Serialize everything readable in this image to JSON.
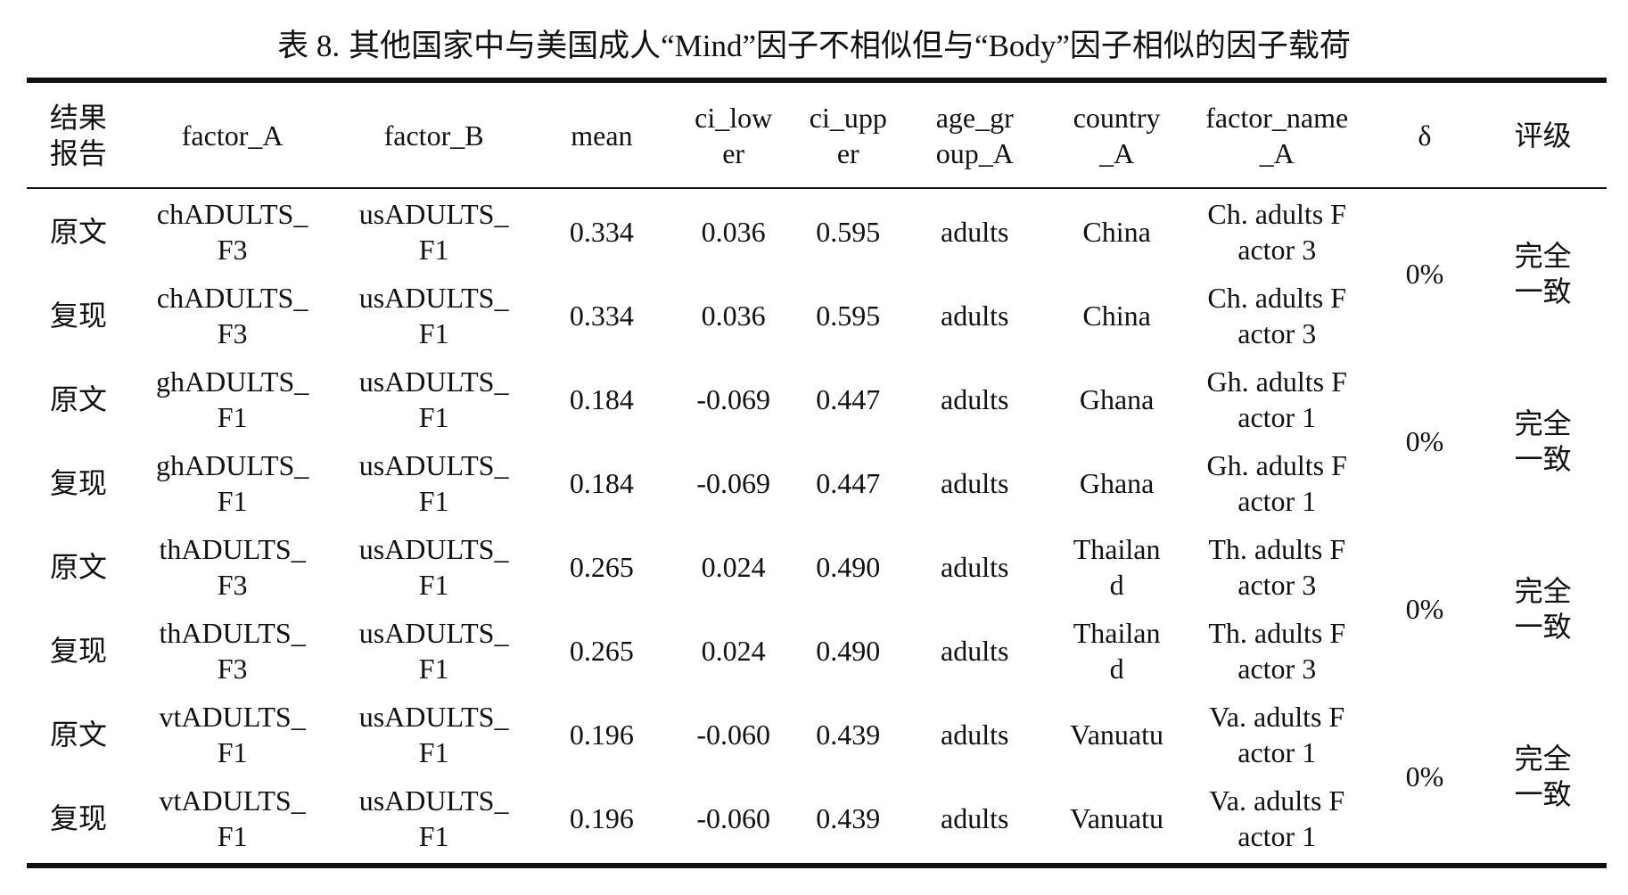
{
  "caption": {
    "prefix": "表 8.",
    "text": "其他国家中与美国成人“Mind”因子不相似但与“Body”因子相似的因子载荷"
  },
  "columns": [
    "结果报告",
    "factor_A",
    "factor_B",
    "mean",
    "ci_lower",
    "ci_upper",
    "age_group_A",
    "country_A",
    "factor_name_A",
    "δ",
    "评级"
  ],
  "rows": [
    {
      "report": "原文",
      "factor_A": "chADULTS_F3",
      "factor_B": "usADULTS_F1",
      "mean": "0.334",
      "ci_lower": "0.036",
      "ci_upper": "0.595",
      "age_group_A": "adults",
      "country_A": "China",
      "factor_name_A": "Ch. adults Factor 3"
    },
    {
      "report": "复现",
      "factor_A": "chADULTS_F3",
      "factor_B": "usADULTS_F1",
      "mean": "0.334",
      "ci_lower": "0.036",
      "ci_upper": "0.595",
      "age_group_A": "adults",
      "country_A": "China",
      "factor_name_A": "Ch. adults Factor 3"
    },
    {
      "report": "原文",
      "factor_A": "ghADULTS_F1",
      "factor_B": "usADULTS_F1",
      "mean": "0.184",
      "ci_lower": "-0.069",
      "ci_upper": "0.447",
      "age_group_A": "adults",
      "country_A": "Ghana",
      "factor_name_A": "Gh. adults Factor 1"
    },
    {
      "report": "复现",
      "factor_A": "ghADULTS_F1",
      "factor_B": "usADULTS_F1",
      "mean": "0.184",
      "ci_lower": "-0.069",
      "ci_upper": "0.447",
      "age_group_A": "adults",
      "country_A": "Ghana",
      "factor_name_A": "Gh. adults Factor 1"
    },
    {
      "report": "原文",
      "factor_A": "thADULTS_F3",
      "factor_B": "usADULTS_F1",
      "mean": "0.265",
      "ci_lower": "0.024",
      "ci_upper": "0.490",
      "age_group_A": "adults",
      "country_A": "Thailand",
      "factor_name_A": "Th. adults Factor 3"
    },
    {
      "report": "复现",
      "factor_A": "thADULTS_F3",
      "factor_B": "usADULTS_F1",
      "mean": "0.265",
      "ci_lower": "0.024",
      "ci_upper": "0.490",
      "age_group_A": "adults",
      "country_A": "Thailand",
      "factor_name_A": "Th. adults Factor 3"
    },
    {
      "report": "原文",
      "factor_A": "vtADULTS_F1",
      "factor_B": "usADULTS_F1",
      "mean": "0.196",
      "ci_lower": "-0.060",
      "ci_upper": "0.439",
      "age_group_A": "adults",
      "country_A": "Vanuatu",
      "factor_name_A": "Va. adults Factor 1"
    },
    {
      "report": "复现",
      "factor_A": "vtADULTS_F1",
      "factor_B": "usADULTS_F1",
      "mean": "0.196",
      "ci_lower": "-0.060",
      "ci_upper": "0.439",
      "age_group_A": "adults",
      "country_A": "Vanuatu",
      "factor_name_A": "Va. adults Factor 1"
    }
  ],
  "groups": [
    {
      "delta": "0%",
      "rating": "完全一致"
    },
    {
      "delta": "0%",
      "rating": "完全一致"
    },
    {
      "delta": "0%",
      "rating": "完全一致"
    },
    {
      "delta": "0%",
      "rating": "完全一致"
    }
  ]
}
